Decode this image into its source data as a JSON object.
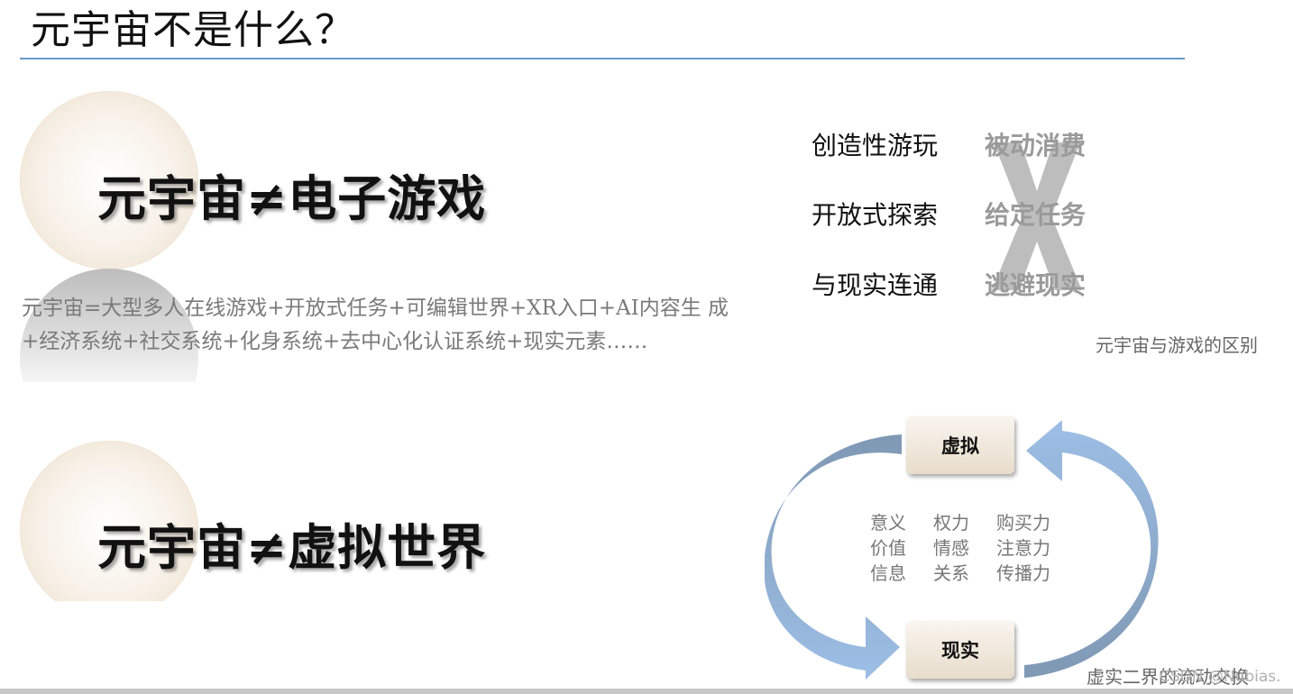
{
  "slide": {
    "title": "元宇宙不是什么？",
    "statement_1": "元宇宙≠电子游戏",
    "statement_2": "元宇宙≠虚拟世界",
    "description": "元宇宙=大型多人在线游戏+开放式任务+可编辑世界+XR入口+AI内容生 成+经济系统+社交系统+化身系统+去中心化认证系统+现实元素……"
  },
  "comparison": {
    "rows": [
      {
        "left": "创造性游玩",
        "right": "被动消费"
      },
      {
        "left": "开放式探索",
        "right": "给定任务"
      },
      {
        "left": "与现实连通",
        "right": "逃避现实"
      }
    ],
    "cross_mark": "X",
    "caption": "元宇宙与游戏的区别"
  },
  "cycle": {
    "top_node": "虚拟",
    "bottom_node": "现实",
    "words": [
      [
        "意义",
        "权力",
        "购买力"
      ],
      [
        "价值",
        "情感",
        "注意力"
      ],
      [
        "信息",
        "关系",
        "传播力"
      ]
    ],
    "caption": "虚实二界的流动交换",
    "watermark": "CSDN @Nubias."
  },
  "colors": {
    "title_rule": "#6b9ac8",
    "arrow_blue": "#8fb3dc",
    "arrow_dark": "#7f98b4"
  }
}
